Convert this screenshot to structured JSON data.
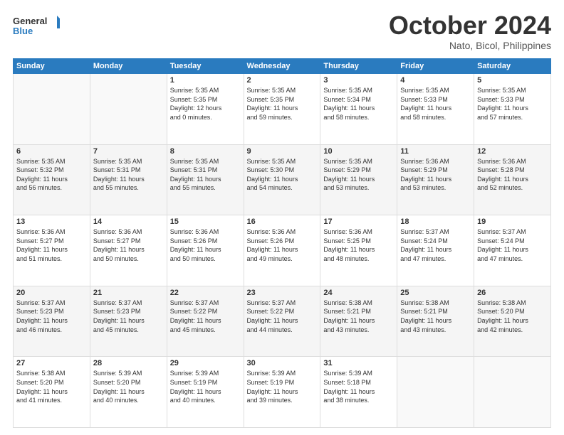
{
  "header": {
    "logo_line1": "General",
    "logo_line2": "Blue",
    "month": "October 2024",
    "location": "Nato, Bicol, Philippines"
  },
  "weekdays": [
    "Sunday",
    "Monday",
    "Tuesday",
    "Wednesday",
    "Thursday",
    "Friday",
    "Saturday"
  ],
  "weeks": [
    [
      {
        "day": "",
        "info": ""
      },
      {
        "day": "",
        "info": ""
      },
      {
        "day": "1",
        "info": "Sunrise: 5:35 AM\nSunset: 5:35 PM\nDaylight: 12 hours\nand 0 minutes."
      },
      {
        "day": "2",
        "info": "Sunrise: 5:35 AM\nSunset: 5:35 PM\nDaylight: 11 hours\nand 59 minutes."
      },
      {
        "day": "3",
        "info": "Sunrise: 5:35 AM\nSunset: 5:34 PM\nDaylight: 11 hours\nand 58 minutes."
      },
      {
        "day": "4",
        "info": "Sunrise: 5:35 AM\nSunset: 5:33 PM\nDaylight: 11 hours\nand 58 minutes."
      },
      {
        "day": "5",
        "info": "Sunrise: 5:35 AM\nSunset: 5:33 PM\nDaylight: 11 hours\nand 57 minutes."
      }
    ],
    [
      {
        "day": "6",
        "info": "Sunrise: 5:35 AM\nSunset: 5:32 PM\nDaylight: 11 hours\nand 56 minutes."
      },
      {
        "day": "7",
        "info": "Sunrise: 5:35 AM\nSunset: 5:31 PM\nDaylight: 11 hours\nand 55 minutes."
      },
      {
        "day": "8",
        "info": "Sunrise: 5:35 AM\nSunset: 5:31 PM\nDaylight: 11 hours\nand 55 minutes."
      },
      {
        "day": "9",
        "info": "Sunrise: 5:35 AM\nSunset: 5:30 PM\nDaylight: 11 hours\nand 54 minutes."
      },
      {
        "day": "10",
        "info": "Sunrise: 5:35 AM\nSunset: 5:29 PM\nDaylight: 11 hours\nand 53 minutes."
      },
      {
        "day": "11",
        "info": "Sunrise: 5:36 AM\nSunset: 5:29 PM\nDaylight: 11 hours\nand 53 minutes."
      },
      {
        "day": "12",
        "info": "Sunrise: 5:36 AM\nSunset: 5:28 PM\nDaylight: 11 hours\nand 52 minutes."
      }
    ],
    [
      {
        "day": "13",
        "info": "Sunrise: 5:36 AM\nSunset: 5:27 PM\nDaylight: 11 hours\nand 51 minutes."
      },
      {
        "day": "14",
        "info": "Sunrise: 5:36 AM\nSunset: 5:27 PM\nDaylight: 11 hours\nand 50 minutes."
      },
      {
        "day": "15",
        "info": "Sunrise: 5:36 AM\nSunset: 5:26 PM\nDaylight: 11 hours\nand 50 minutes."
      },
      {
        "day": "16",
        "info": "Sunrise: 5:36 AM\nSunset: 5:26 PM\nDaylight: 11 hours\nand 49 minutes."
      },
      {
        "day": "17",
        "info": "Sunrise: 5:36 AM\nSunset: 5:25 PM\nDaylight: 11 hours\nand 48 minutes."
      },
      {
        "day": "18",
        "info": "Sunrise: 5:37 AM\nSunset: 5:24 PM\nDaylight: 11 hours\nand 47 minutes."
      },
      {
        "day": "19",
        "info": "Sunrise: 5:37 AM\nSunset: 5:24 PM\nDaylight: 11 hours\nand 47 minutes."
      }
    ],
    [
      {
        "day": "20",
        "info": "Sunrise: 5:37 AM\nSunset: 5:23 PM\nDaylight: 11 hours\nand 46 minutes."
      },
      {
        "day": "21",
        "info": "Sunrise: 5:37 AM\nSunset: 5:23 PM\nDaylight: 11 hours\nand 45 minutes."
      },
      {
        "day": "22",
        "info": "Sunrise: 5:37 AM\nSunset: 5:22 PM\nDaylight: 11 hours\nand 45 minutes."
      },
      {
        "day": "23",
        "info": "Sunrise: 5:37 AM\nSunset: 5:22 PM\nDaylight: 11 hours\nand 44 minutes."
      },
      {
        "day": "24",
        "info": "Sunrise: 5:38 AM\nSunset: 5:21 PM\nDaylight: 11 hours\nand 43 minutes."
      },
      {
        "day": "25",
        "info": "Sunrise: 5:38 AM\nSunset: 5:21 PM\nDaylight: 11 hours\nand 43 minutes."
      },
      {
        "day": "26",
        "info": "Sunrise: 5:38 AM\nSunset: 5:20 PM\nDaylight: 11 hours\nand 42 minutes."
      }
    ],
    [
      {
        "day": "27",
        "info": "Sunrise: 5:38 AM\nSunset: 5:20 PM\nDaylight: 11 hours\nand 41 minutes."
      },
      {
        "day": "28",
        "info": "Sunrise: 5:39 AM\nSunset: 5:20 PM\nDaylight: 11 hours\nand 40 minutes."
      },
      {
        "day": "29",
        "info": "Sunrise: 5:39 AM\nSunset: 5:19 PM\nDaylight: 11 hours\nand 40 minutes."
      },
      {
        "day": "30",
        "info": "Sunrise: 5:39 AM\nSunset: 5:19 PM\nDaylight: 11 hours\nand 39 minutes."
      },
      {
        "day": "31",
        "info": "Sunrise: 5:39 AM\nSunset: 5:18 PM\nDaylight: 11 hours\nand 38 minutes."
      },
      {
        "day": "",
        "info": ""
      },
      {
        "day": "",
        "info": ""
      }
    ]
  ]
}
